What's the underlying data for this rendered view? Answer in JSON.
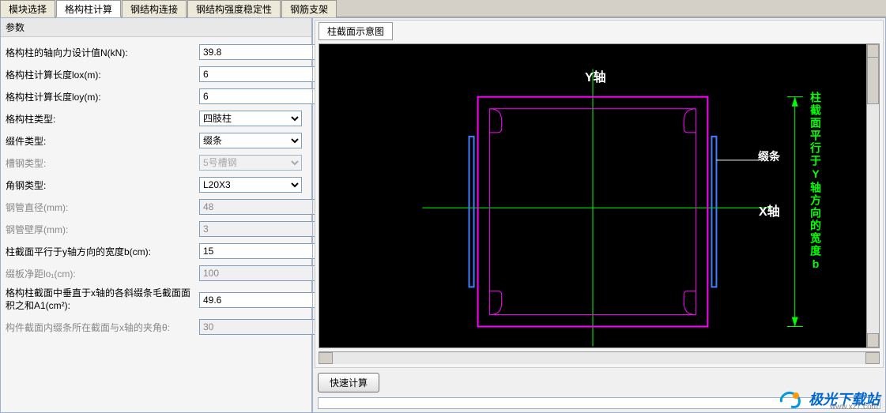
{
  "tabs": {
    "module_select": "模块选择",
    "lattice_column": "格构柱计算",
    "steel_connection": "钢结构连接",
    "steel_strength": "钢结构强度稳定性",
    "rebar_support": "钢筋支架"
  },
  "left_panel": {
    "title": "参数",
    "params": {
      "axial_force": {
        "label": "格构柱的轴向力设计值N(kN):",
        "value": "39.8"
      },
      "calc_length_lox": {
        "label": "格构柱计算长度lox(m):",
        "value": "6"
      },
      "calc_length_loy": {
        "label": "格构柱计算长度loy(m):",
        "value": "6"
      },
      "column_type": {
        "label": "格构柱类型:",
        "value": "四肢柱"
      },
      "lacing_type": {
        "label": "缀件类型:",
        "value": "缀条"
      },
      "channel_type": {
        "label": "槽钢类型:",
        "value": "5号槽钢"
      },
      "angle_type": {
        "label": "角钢类型:",
        "value": "L20X3"
      },
      "pipe_diameter": {
        "label": "钢管直径(mm):",
        "value": "48"
      },
      "pipe_thickness": {
        "label": "钢管壁厚(mm):",
        "value": "3"
      },
      "section_width_b": {
        "label": "柱截面平行于y轴方向的宽度b(cm):",
        "value": "15"
      },
      "lacing_clear_span": {
        "label": "缀板净距lo₁(cm):",
        "value": "100"
      },
      "lacing_area_a1": {
        "label": "格构柱截面中垂直于x轴的各斜缀条毛截面面积之和A1(cm²):",
        "value": "49.6"
      },
      "lacing_angle": {
        "label": "构件截面内缀条所在截面与x轴的夹角θ:",
        "value": "30"
      }
    }
  },
  "diagram": {
    "title": "柱截面示意图",
    "y_axis": "Y轴",
    "x_axis": "X轴",
    "lacing_label": "缀条",
    "vertical_label": "柱截面平行于Y轴方向的宽度b"
  },
  "calc_button": "快速计算",
  "watermark": {
    "text": "极光下载站",
    "sub": "www.xz7.com"
  }
}
